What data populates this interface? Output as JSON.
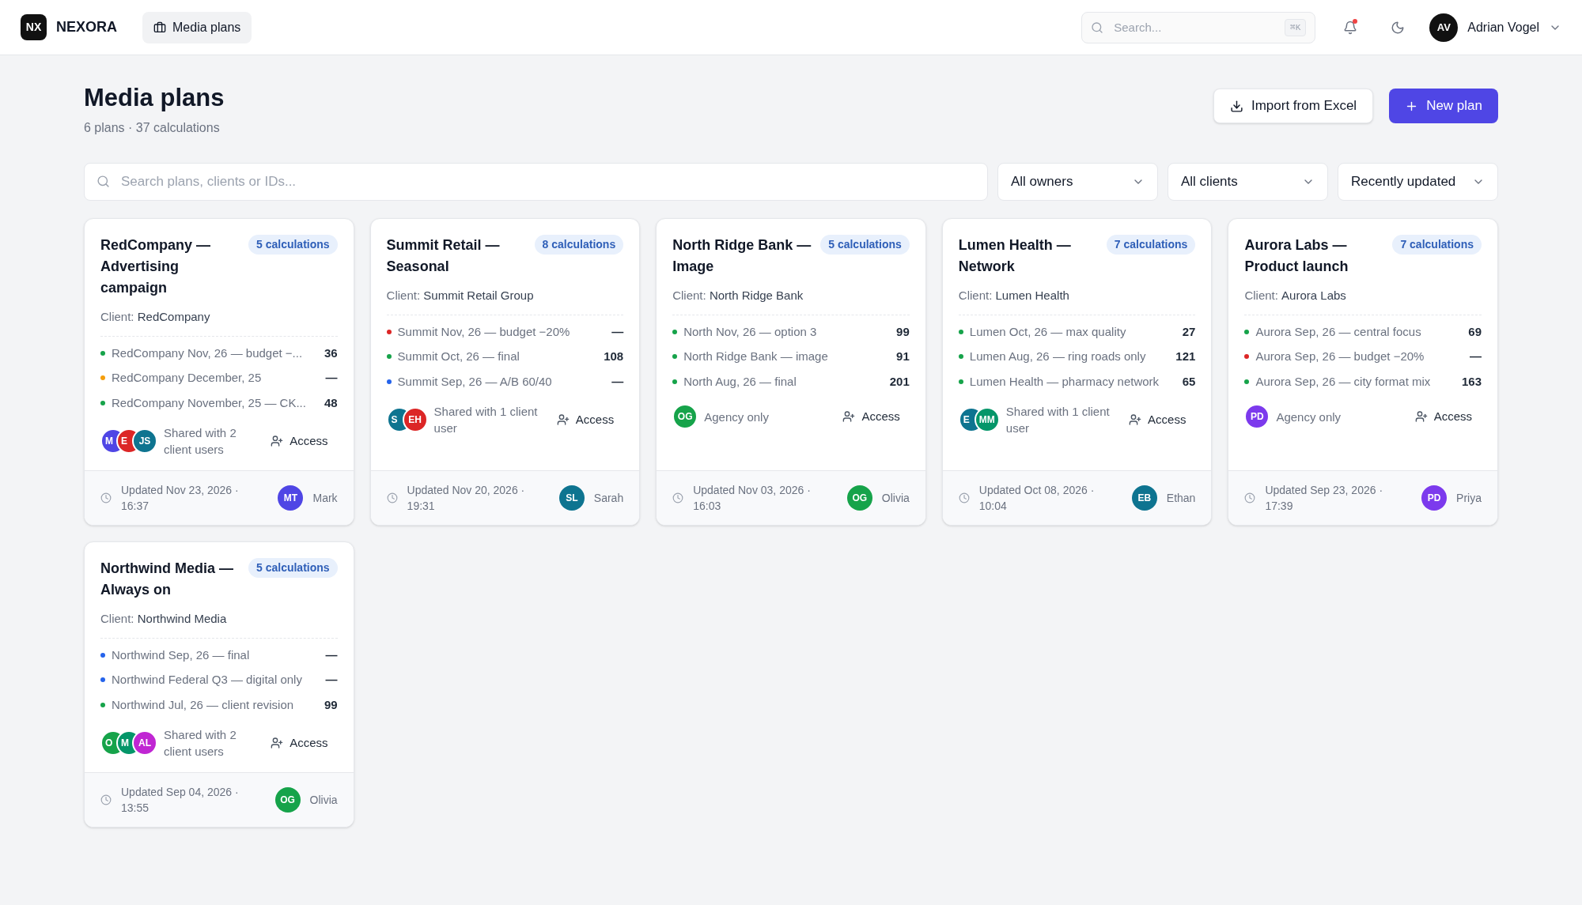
{
  "topbar": {
    "logo_mark": "NX",
    "brand": "NEXORA",
    "nav": [
      {
        "label": "Media plans",
        "selected": true
      }
    ],
    "search": {
      "placeholder": "Search...",
      "shortcut": "⌘K"
    },
    "notifications": {
      "unread": true
    },
    "user": {
      "initials": "AV",
      "name": "Adrian Vogel"
    }
  },
  "page": {
    "title": "Media plans",
    "subtitle": "6 plans · 37 calculations",
    "actions": [
      {
        "kind": "secondary",
        "label": "Import from Excel"
      },
      {
        "kind": "primary",
        "label": "New plan"
      }
    ]
  },
  "filters": {
    "search": {
      "placeholder": "Search plans, clients or IDs..."
    },
    "selects": [
      {
        "value": "All owners"
      },
      {
        "value": "All clients"
      },
      {
        "value": "Recently updated"
      }
    ]
  },
  "plans": [
    {
      "title": "RedCompany — Advertising campaign",
      "badge": "5 calculations",
      "client_label": "Client:",
      "client": "RedCompany",
      "calculations": [
        {
          "name": "RedCompany Nov, 26 — budget −...",
          "value": "36",
          "color": "#16a34a"
        },
        {
          "name": "RedCompany December, 25",
          "value": "—",
          "color": "#f59e0b"
        },
        {
          "name": "RedCompany November, 25 — CK...",
          "value": "48",
          "color": "#16a34a"
        }
      ],
      "sharing": {
        "avatars": [
          {
            "initials": "M",
            "color": "#4f46e5"
          },
          {
            "initials": "E",
            "color": "#dc2626"
          },
          {
            "initials": "JS",
            "color": "#0e7490"
          }
        ],
        "text": "Shared with 2 client users"
      },
      "access": "Access",
      "updated": "Updated Nov 23, 2026 · 16:37",
      "owner": {
        "initials": "MT",
        "name": "Mark",
        "color": "#4f46e5"
      }
    },
    {
      "title": "Summit Retail — Seasonal",
      "badge": "8 calculations",
      "client_label": "Client:",
      "client": "Summit Retail Group",
      "calculations": [
        {
          "name": "Summit Nov, 26 — budget −20%",
          "value": "—",
          "color": "#dc2626"
        },
        {
          "name": "Summit Oct, 26 — final",
          "value": "108",
          "color": "#16a34a"
        },
        {
          "name": "Summit Sep, 26 — A/B 60/40",
          "value": "—",
          "color": "#2563eb"
        }
      ],
      "sharing": {
        "avatars": [
          {
            "initials": "S",
            "color": "#0e7490"
          },
          {
            "initials": "EH",
            "color": "#dc2626"
          }
        ],
        "text": "Shared with 1 client user"
      },
      "access": "Access",
      "updated": "Updated Nov 20, 2026 · 19:31",
      "owner": {
        "initials": "SL",
        "name": "Sarah",
        "color": "#0e7490"
      }
    },
    {
      "title": "North Ridge Bank — Image",
      "badge": "5 calculations",
      "client_label": "Client:",
      "client": "North Ridge Bank",
      "calculations": [
        {
          "name": "North Nov, 26 — option 3",
          "value": "99",
          "color": "#16a34a"
        },
        {
          "name": "North Ridge Bank — image",
          "value": "91",
          "color": "#16a34a"
        },
        {
          "name": "North Aug, 26 — final",
          "value": "201",
          "color": "#16a34a"
        }
      ],
      "sharing": {
        "avatars": [
          {
            "initials": "OG",
            "color": "#16a34a"
          }
        ],
        "text": "Agency only"
      },
      "access": "Access",
      "updated": "Updated Nov 03, 2026 · 16:03",
      "owner": {
        "initials": "OG",
        "name": "Olivia",
        "color": "#16a34a"
      }
    },
    {
      "title": "Lumen Health — Network",
      "badge": "7 calculations",
      "client_label": "Client:",
      "client": "Lumen Health",
      "calculations": [
        {
          "name": "Lumen Oct, 26 — max quality",
          "value": "27",
          "color": "#16a34a"
        },
        {
          "name": "Lumen Aug, 26 — ring roads only",
          "value": "121",
          "color": "#16a34a"
        },
        {
          "name": "Lumen Health — pharmacy network",
          "value": "65",
          "color": "#16a34a"
        }
      ],
      "sharing": {
        "avatars": [
          {
            "initials": "E",
            "color": "#0e7490"
          },
          {
            "initials": "MM",
            "color": "#059669"
          }
        ],
        "text": "Shared with 1 client user"
      },
      "access": "Access",
      "updated": "Updated Oct 08, 2026 · 10:04",
      "owner": {
        "initials": "EB",
        "name": "Ethan",
        "color": "#0e7490"
      }
    },
    {
      "title": "Aurora Labs — Product launch",
      "badge": "7 calculations",
      "client_label": "Client:",
      "client": "Aurora Labs",
      "calculations": [
        {
          "name": "Aurora Sep, 26 — central focus",
          "value": "69",
          "color": "#16a34a"
        },
        {
          "name": "Aurora Sep, 26 — budget −20%",
          "value": "—",
          "color": "#dc2626"
        },
        {
          "name": "Aurora Sep, 26 — city format mix",
          "value": "163",
          "color": "#16a34a"
        }
      ],
      "sharing": {
        "avatars": [
          {
            "initials": "PD",
            "color": "#7c3aed"
          }
        ],
        "text": "Agency only"
      },
      "access": "Access",
      "updated": "Updated Sep 23, 2026 · 17:39",
      "owner": {
        "initials": "PD",
        "name": "Priya",
        "color": "#7c3aed"
      }
    },
    {
      "title": "Northwind Media — Always on",
      "badge": "5 calculations",
      "client_label": "Client:",
      "client": "Northwind Media",
      "calculations": [
        {
          "name": "Northwind Sep, 26 — final",
          "value": "—",
          "color": "#2563eb"
        },
        {
          "name": "Northwind Federal Q3 — digital only",
          "value": "—",
          "color": "#2563eb"
        },
        {
          "name": "Northwind Jul, 26 — client revision",
          "value": "99",
          "color": "#16a34a"
        }
      ],
      "sharing": {
        "avatars": [
          {
            "initials": "O",
            "color": "#16a34a"
          },
          {
            "initials": "M",
            "color": "#059669"
          },
          {
            "initials": "AL",
            "color": "#c026d3"
          }
        ],
        "text": "Shared with 2 client users"
      },
      "access": "Access",
      "updated": "Updated Sep 04, 2026 · 13:55",
      "owner": {
        "initials": "OG",
        "name": "Olivia",
        "color": "#16a34a"
      }
    }
  ]
}
